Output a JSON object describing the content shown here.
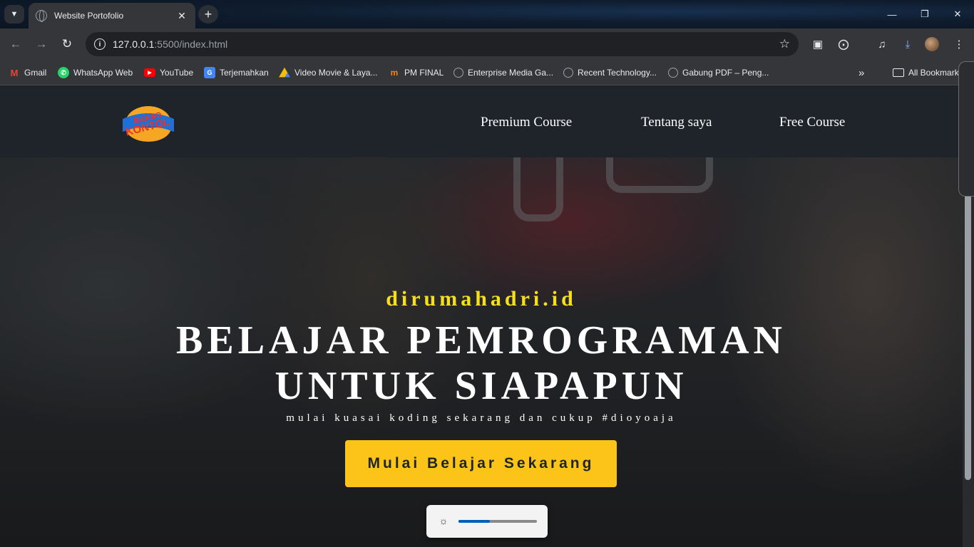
{
  "browser": {
    "tab_title": "Website Portofolio",
    "url_host": "127.0.0.1",
    "url_path": ":5500/index.html",
    "bookmarks": [
      {
        "label": "Gmail",
        "icon": "gmail-icon",
        "color": "#ea4335"
      },
      {
        "label": "WhatsApp Web",
        "icon": "whatsapp-icon",
        "color": "#25d366"
      },
      {
        "label": "YouTube",
        "icon": "youtube-icon",
        "color": "#ff0000"
      },
      {
        "label": "Terjemahkan",
        "icon": "translate-icon",
        "color": "#4285f4"
      },
      {
        "label": "Video Movie & Laya...",
        "icon": "drive-icon",
        "color": "#fbbc04"
      },
      {
        "label": "PM FINAL",
        "icon": "moodle-icon",
        "color": "#f98012"
      },
      {
        "label": "Enterprise Media Ga...",
        "icon": "globe-icon",
        "color": "#9aa0a6"
      },
      {
        "label": "Recent Technology...",
        "icon": "globe-icon",
        "color": "#9aa0a6"
      },
      {
        "label": "Gabung PDF – Peng...",
        "icon": "globe-icon",
        "color": "#9aa0a6"
      }
    ],
    "all_bookmarks_label": "All Bookmarks"
  },
  "site": {
    "logo": {
      "line1": "BAKSO",
      "line2": "KONTOL"
    },
    "nav": [
      "Premium Course",
      "Tentang saya",
      "Free Course"
    ],
    "hero": {
      "brand": "dirumahadri.id",
      "headline_line1": "BELAJAR PEMROGRAMAN",
      "headline_line2": "UNTUK SIAPAPUN",
      "tagline": "mulai kuasai koding sekarang dan cukup #dioyoaja",
      "cta": "Mulai Belajar Sekarang"
    }
  },
  "brightness_overlay": {
    "level": 0.4
  },
  "colors": {
    "accent_yellow": "#fcc419",
    "brand_yellow": "#f7e01b",
    "nav_bg": "#1f242b"
  }
}
